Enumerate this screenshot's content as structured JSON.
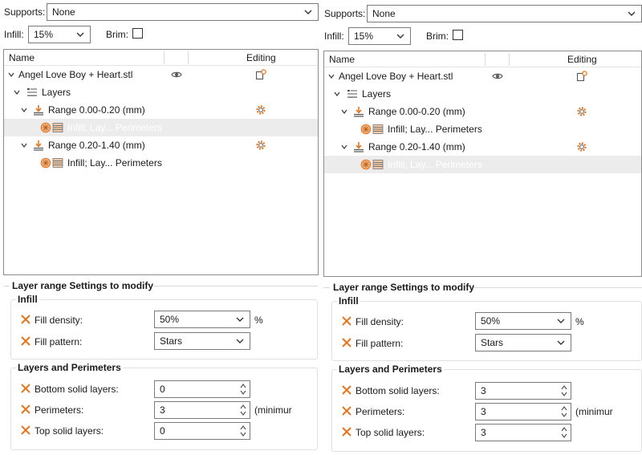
{
  "left": {
    "supports": {
      "label": "Supports:",
      "value": "None"
    },
    "infill": {
      "label": "Infill:",
      "value": "15%"
    },
    "brim": {
      "label": "Brim:"
    },
    "tree": {
      "headers": {
        "name": "Name",
        "editing": "Editing"
      },
      "rows": [
        {
          "label": "Angel Love Boy + Heart.stl"
        },
        {
          "label": "Layers"
        },
        {
          "label": "Range 0.00-0.20 (mm)"
        },
        {
          "label": "Infill; Lay... Perimeters"
        },
        {
          "label": "Range 0.20-1.40 (mm)"
        },
        {
          "label": "Infill; Lay... Perimeters"
        }
      ]
    },
    "settings": {
      "title": "Layer range Settings to modify",
      "infill_group": "Infill",
      "fill_density": {
        "label": "Fill density:",
        "value": "50%",
        "unit": "%"
      },
      "fill_pattern": {
        "label": "Fill pattern:",
        "value": "Stars"
      },
      "layers_group": "Layers and Perimeters",
      "bottom_solid": {
        "label": "Bottom solid layers:",
        "value": "0"
      },
      "perimeters": {
        "label": "Perimeters:",
        "value": "3",
        "unit": "(minimur"
      },
      "top_solid": {
        "label": "Top solid layers:",
        "value": "0"
      }
    }
  },
  "right": {
    "supports": {
      "label": "Supports:",
      "value": "None"
    },
    "infill": {
      "label": "Infill:",
      "value": "15%"
    },
    "brim": {
      "label": "Brim:"
    },
    "tree": {
      "headers": {
        "name": "Name",
        "editing": "Editing"
      },
      "rows": [
        {
          "label": "Angel Love Boy + Heart.stl"
        },
        {
          "label": "Layers"
        },
        {
          "label": "Range 0.00-0.20 (mm)"
        },
        {
          "label": "Infill; Lay... Perimeters"
        },
        {
          "label": "Range 0.20-1.40 (mm)"
        },
        {
          "label": "Infill; Lay... Perimeters"
        }
      ]
    },
    "settings": {
      "title": "Layer range Settings to modify",
      "infill_group": "Infill",
      "fill_density": {
        "label": "Fill density:",
        "value": "50%",
        "unit": "%"
      },
      "fill_pattern": {
        "label": "Fill pattern:",
        "value": "Stars"
      },
      "layers_group": "Layers and Perimeters",
      "bottom_solid": {
        "label": "Bottom solid layers:",
        "value": "3"
      },
      "perimeters": {
        "label": "Perimeters:",
        "value": "3",
        "unit": "(minimur"
      },
      "top_solid": {
        "label": "Top solid layers:",
        "value": "3"
      }
    }
  },
  "colors": {
    "accent": "#e8741e",
    "icon_gray": "#555555",
    "selection": "#ececec"
  },
  "icons": [
    "chevron-down-icon",
    "eye-icon",
    "edit-object-icon",
    "expand-arrow-icon",
    "layers-icon",
    "range-icon",
    "settings-gear-icon",
    "infill-icon",
    "perimeters-icon",
    "reset-x-icon",
    "spin-arrows-icon"
  ]
}
